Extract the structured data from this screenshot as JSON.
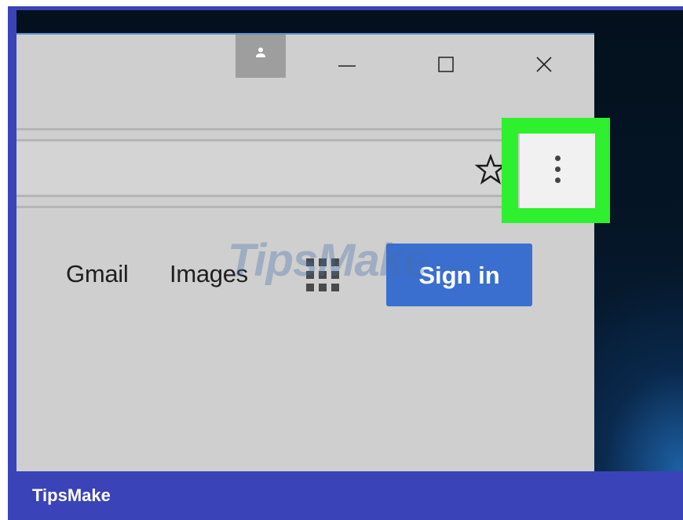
{
  "window": {
    "controls": {
      "profile_icon": "person-icon",
      "minimize_icon": "minimize-icon",
      "maximize_icon": "maximize-icon",
      "close_icon": "close-icon"
    }
  },
  "toolbar": {
    "bookmark_icon": "star-icon",
    "menu_icon": "three-dots-vertical-icon",
    "highlight_color": "#2ef02e"
  },
  "page": {
    "links": {
      "gmail": "Gmail",
      "images": "Images"
    },
    "apps_icon": "apps-grid-icon",
    "signin_label": "Sign in",
    "signin_color": "#3a6fd0"
  },
  "watermark": "TipsMake",
  "footer": {
    "brand": "TipsMake",
    "color": "#3b43b8"
  }
}
